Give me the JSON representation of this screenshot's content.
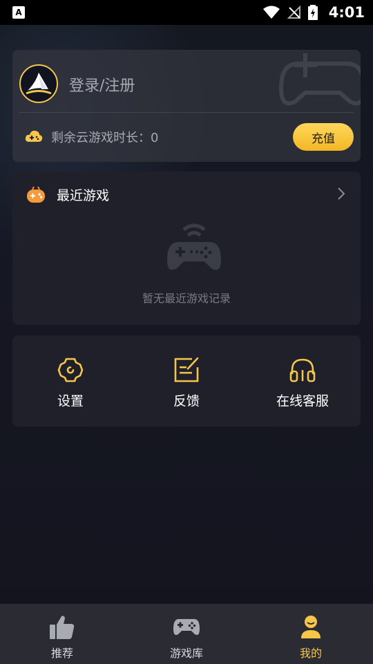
{
  "status_bar": {
    "time": "4:01",
    "notification_letter": "A"
  },
  "login_card": {
    "login_text": "登录/注册",
    "remaining_label": "剩余云游戏时长：0",
    "recharge_label": "充值"
  },
  "recent_games": {
    "title": "最近游戏",
    "empty_text": "暂无最近游戏记录"
  },
  "tools": [
    {
      "label": "设置",
      "icon": "gear-icon"
    },
    {
      "label": "反馈",
      "icon": "feedback-icon"
    },
    {
      "label": "在线客服",
      "icon": "headset-icon"
    }
  ],
  "bottom_nav": [
    {
      "label": "推荐",
      "icon": "thumbs-up-icon",
      "active": false
    },
    {
      "label": "游戏库",
      "icon": "gamepad-icon",
      "active": false
    },
    {
      "label": "我的",
      "icon": "user-icon",
      "active": true
    }
  ],
  "colors": {
    "accent": "#f5c64a",
    "background": "#151722",
    "card": "#1f202a",
    "nav": "#2a2b33"
  }
}
